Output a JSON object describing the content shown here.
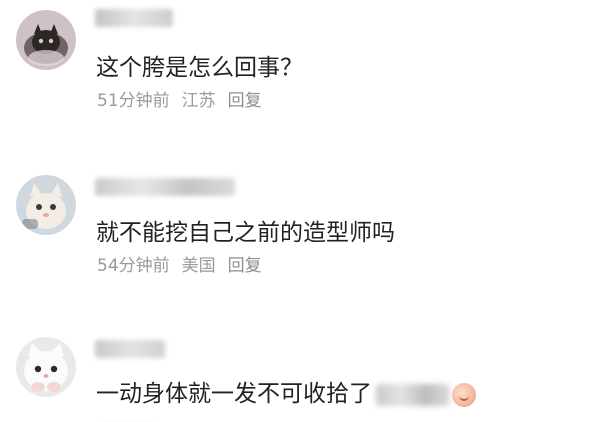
{
  "comments": [
    {
      "text": "这个胯是怎么回事？",
      "time": "51分钟前",
      "location": "江苏",
      "reply": "回复",
      "avatar_icon": "dark-cat-avatar-icon"
    },
    {
      "text": "就不能挖自己之前的造型师吗",
      "time": "54分钟前",
      "location": "美国",
      "reply": "回复",
      "avatar_icon": "pale-cat-avatar-icon"
    },
    {
      "text": "一动身体就一发不可收拾了",
      "time": "",
      "location": "",
      "reply": "",
      "avatar_icon": "white-cat-avatar-icon",
      "trailing_icon": "face-emoji-icon"
    }
  ],
  "colors": {
    "text": "#222222",
    "meta": "#9a9a9a",
    "background": "#ffffff"
  }
}
